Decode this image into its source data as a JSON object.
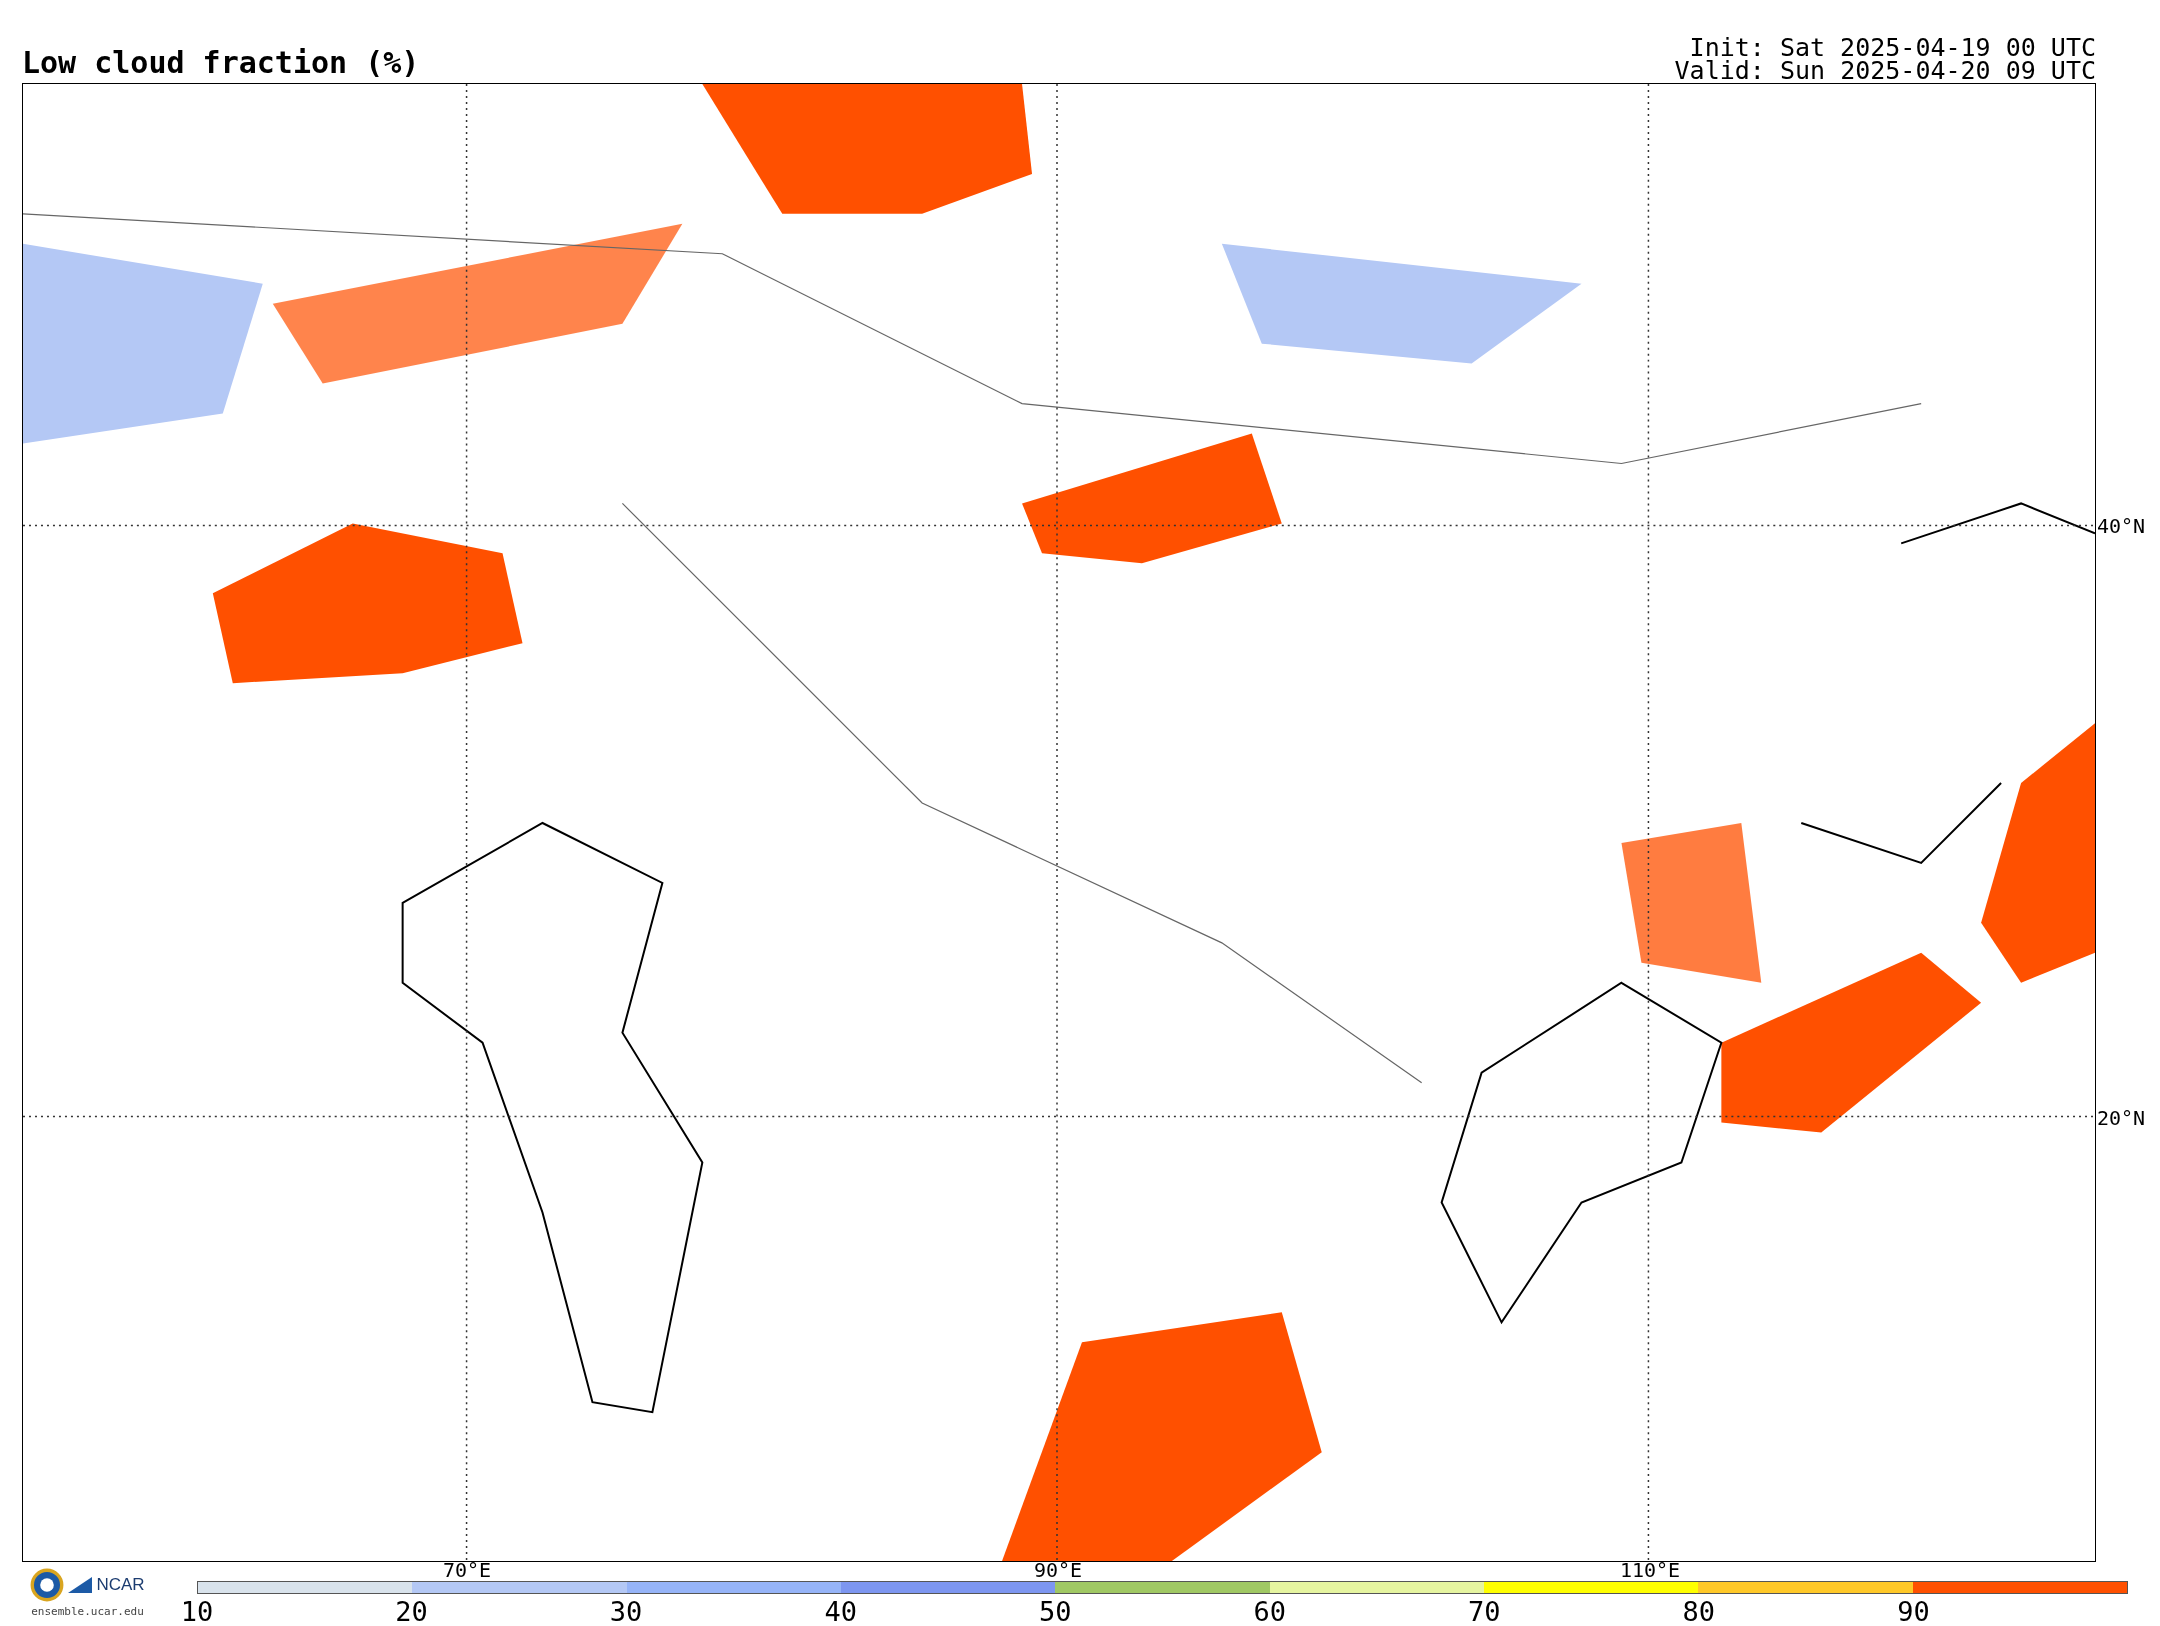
{
  "title": "Low cloud fraction (%)",
  "init": "Init: Sat 2025-04-19 00 UTC",
  "valid": "Valid: Sun 2025-04-20 09 UTC",
  "map": {
    "lat_labels": [
      "40°N",
      "20°N"
    ],
    "lon_labels": [
      "70°E",
      "90°E",
      "110°E"
    ]
  },
  "logo": {
    "name": "NCAR",
    "url": "ensemble.ucar.edu"
  },
  "colorbar": {
    "segments": [
      {
        "color": "#d9e3ec"
      },
      {
        "color": "#b4c8f5"
      },
      {
        "color": "#96b4f8"
      },
      {
        "color": "#7d96f0"
      },
      {
        "color": "#a0c864"
      },
      {
        "color": "#e6f5a0"
      },
      {
        "color": "#ffff00"
      },
      {
        "color": "#ffc828"
      },
      {
        "color": "#ff5000"
      }
    ],
    "ticks": [
      "10",
      "20",
      "30",
      "40",
      "50",
      "60",
      "70",
      "80",
      "90"
    ]
  }
}
